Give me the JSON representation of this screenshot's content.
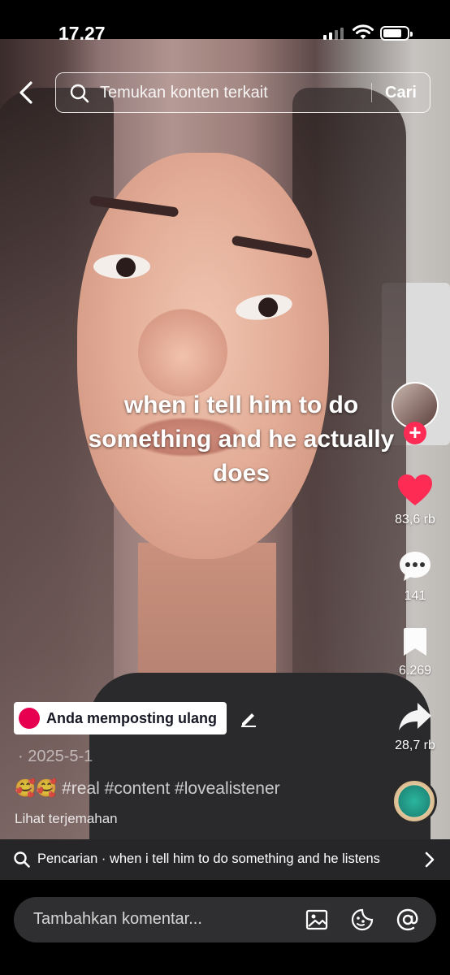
{
  "status_bar": {
    "time": "17.27"
  },
  "search": {
    "placeholder": "Temukan konten terkait",
    "button": "Cari"
  },
  "video": {
    "caption": "when i tell him to do something and he actually does"
  },
  "rail": {
    "likes": "83,6 rb",
    "comments": "141",
    "saves": "6.269",
    "shares": "28,7 rb"
  },
  "post": {
    "repost_label": "Anda memposting ulang",
    "date": "· 2025-5-1",
    "description": "🥰🥰 #real #content #lovealistener",
    "translate": "Lihat terjemahan"
  },
  "suggestion": {
    "text": "Pencarian · when i tell him to do something and he listens"
  },
  "comment_bar": {
    "placeholder": "Tambahkan komentar..."
  },
  "colors": {
    "like": "#fe2c55",
    "accent": "#fe2c55",
    "repost_dot": "#e6004f"
  },
  "icons": [
    "back-icon",
    "search-icon",
    "heart-icon",
    "comment-icon",
    "bookmark-icon",
    "share-icon",
    "edit-icon",
    "image-icon",
    "sticker-icon",
    "mention-icon",
    "chevron-right-icon"
  ]
}
